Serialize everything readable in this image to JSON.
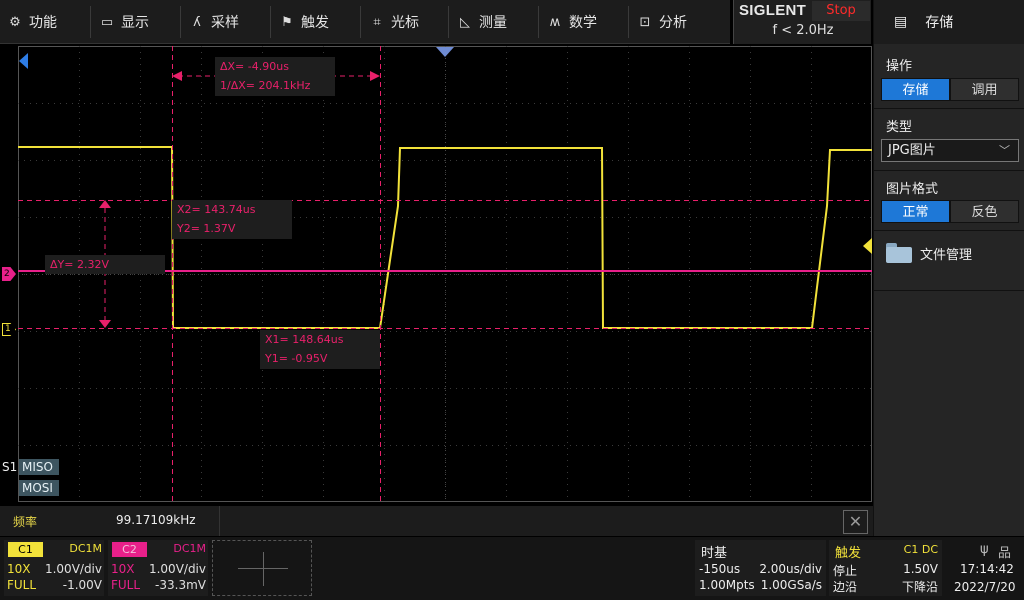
{
  "menu": {
    "items": [
      {
        "name": "menu-function",
        "icon": "gear-icon",
        "glyph": "⚙",
        "label": "功能"
      },
      {
        "name": "menu-display",
        "icon": "monitor-icon",
        "glyph": "▭",
        "label": "显示"
      },
      {
        "name": "menu-acquire",
        "icon": "waveform-icon",
        "glyph": "ʎ",
        "label": "采样"
      },
      {
        "name": "menu-trigger",
        "icon": "flag-icon",
        "glyph": "⚑",
        "label": "触发"
      },
      {
        "name": "menu-cursor",
        "icon": "crosshair-icon",
        "glyph": "⌗",
        "label": "光标"
      },
      {
        "name": "menu-measure",
        "icon": "ruler-icon",
        "glyph": "◺",
        "label": "测量"
      },
      {
        "name": "menu-math",
        "icon": "math-icon",
        "glyph": "ʍ",
        "label": "数学"
      },
      {
        "name": "menu-analysis",
        "icon": "analysis-icon",
        "glyph": "⊡",
        "label": "分析"
      }
    ]
  },
  "brand": {
    "logo": "SIGLENT",
    "status": "Stop",
    "frequency": "f < 2.0Hz"
  },
  "panel": {
    "header_icon_glyph": "▤",
    "title": "存储",
    "operation_label": "操作",
    "operation_options": [
      "存储",
      "调用"
    ],
    "type_label": "类型",
    "type_value": "JPG图片",
    "format_label": "图片格式",
    "format_options": [
      "正常",
      "反色"
    ],
    "file_manager": "文件管理"
  },
  "cursors": {
    "delta_x": "ΔX= -4.90us",
    "inv_delta_x": "1/ΔX= 204.1kHz",
    "x2": "X2= 143.74us",
    "y2": "Y2= 1.37V",
    "delta_y": "ΔY= 2.32V",
    "x1": "X1= 148.64us",
    "y1": "Y1= -0.95V"
  },
  "labels": {
    "s1": "S1",
    "miso": "MISO",
    "mosi": "MOSI",
    "ch2_marker": "2",
    "ch1_marker": "1"
  },
  "measurement": {
    "label": "频率",
    "value": "99.17109kHz",
    "close_glyph": "✕"
  },
  "channels": [
    {
      "tag": "C1",
      "coupling": "DC1M",
      "probe": "10X",
      "scale": "1.00V/div",
      "bw": "FULL",
      "offset": "-1.00V",
      "color": "#f2e23a"
    },
    {
      "tag": "C2",
      "coupling": "DC1M",
      "probe": "10X",
      "scale": "1.00V/div",
      "bw": "FULL",
      "offset": "-33.3mV",
      "color": "#e8208a"
    }
  ],
  "timebase": {
    "title": "时基",
    "delay": "-150us",
    "scale": "2.00us/div",
    "memory": "1.00Mpts",
    "rate": "1.00GSa/s"
  },
  "trigger": {
    "title": "触发",
    "source": "C1 DC",
    "mode": "停止",
    "level": "1.50V",
    "type": "边沿",
    "slope": "下降沿"
  },
  "system": {
    "usb_glyph": "ψ",
    "network_glyph": "品",
    "time": "17:14:42",
    "date": "2022/7/20"
  },
  "colors": {
    "ch1": "#f2e23a",
    "ch2": "#e8208a",
    "cursor": "#e8206a",
    "accent": "#1e78d7",
    "grid": "#3a3a3a"
  }
}
